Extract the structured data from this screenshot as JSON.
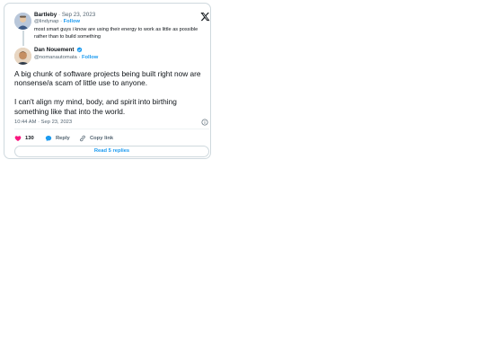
{
  "reply_tweet": {
    "author_name": "Bartleby",
    "date": "Sep 23, 2023",
    "handle": "@lindynap",
    "follow_label": "Follow",
    "text": "most smart guys i know are using their energy to work as little as possible rather than to build something"
  },
  "main_tweet": {
    "author_name": "Dan Nouement",
    "handle": "@nomanautomata",
    "follow_label": "Follow",
    "paragraph_1": "A big chunk of software projects being built right now are nonsense/a scam of little use to anyone.",
    "paragraph_2": "I can't align my mind, body, and spirit into birthing something like that into the world.",
    "timestamp": "10:44 AM · Sep 23, 2023"
  },
  "actions": {
    "like_count": "130",
    "reply_label": "Reply",
    "copy_label": "Copy link",
    "read_replies_label": "Read 5 replies"
  },
  "separator": " · ",
  "colors": {
    "accent": "#1d9bf0",
    "like": "#f91880",
    "text": "#0f1419",
    "muted": "#536471",
    "border": "#cfd9de"
  },
  "icons": [
    "x-logo-icon",
    "verified-badge-icon",
    "info-icon",
    "heart-icon",
    "reply-bubble-icon",
    "link-icon"
  ]
}
